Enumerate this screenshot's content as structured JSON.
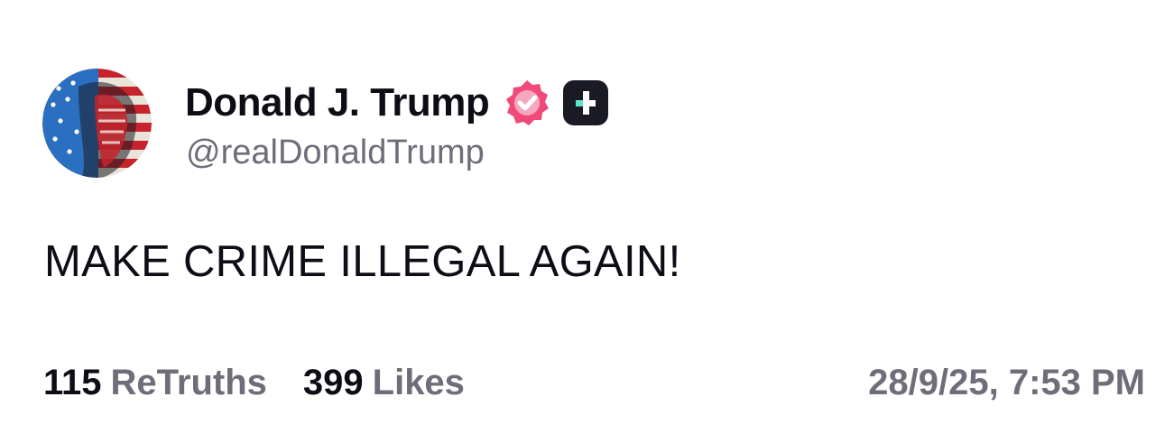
{
  "author": {
    "display_name": "Donald J. Trump",
    "handle": "@realDonaldTrump",
    "avatar_icon": "avatar-flag-portrait-icon",
    "verified_icon": "verified-badge-icon",
    "verified_color": "#f0497a",
    "plus_icon": "truth-plus-badge-icon",
    "plus_color": "#1a1a24",
    "plus_accent": "#5fe3c9"
  },
  "post": {
    "text": "MAKE CRIME ILLEGAL AGAIN!"
  },
  "stats": {
    "retruths_count": "115",
    "retruths_label": "ReTruths",
    "likes_count": "399",
    "likes_label": "Likes"
  },
  "timestamp": "28/9/25, 7:53 PM",
  "colors": {
    "text_primary": "#0d0d16",
    "text_secondary": "#6e6d7a",
    "background": "#ffffff"
  }
}
